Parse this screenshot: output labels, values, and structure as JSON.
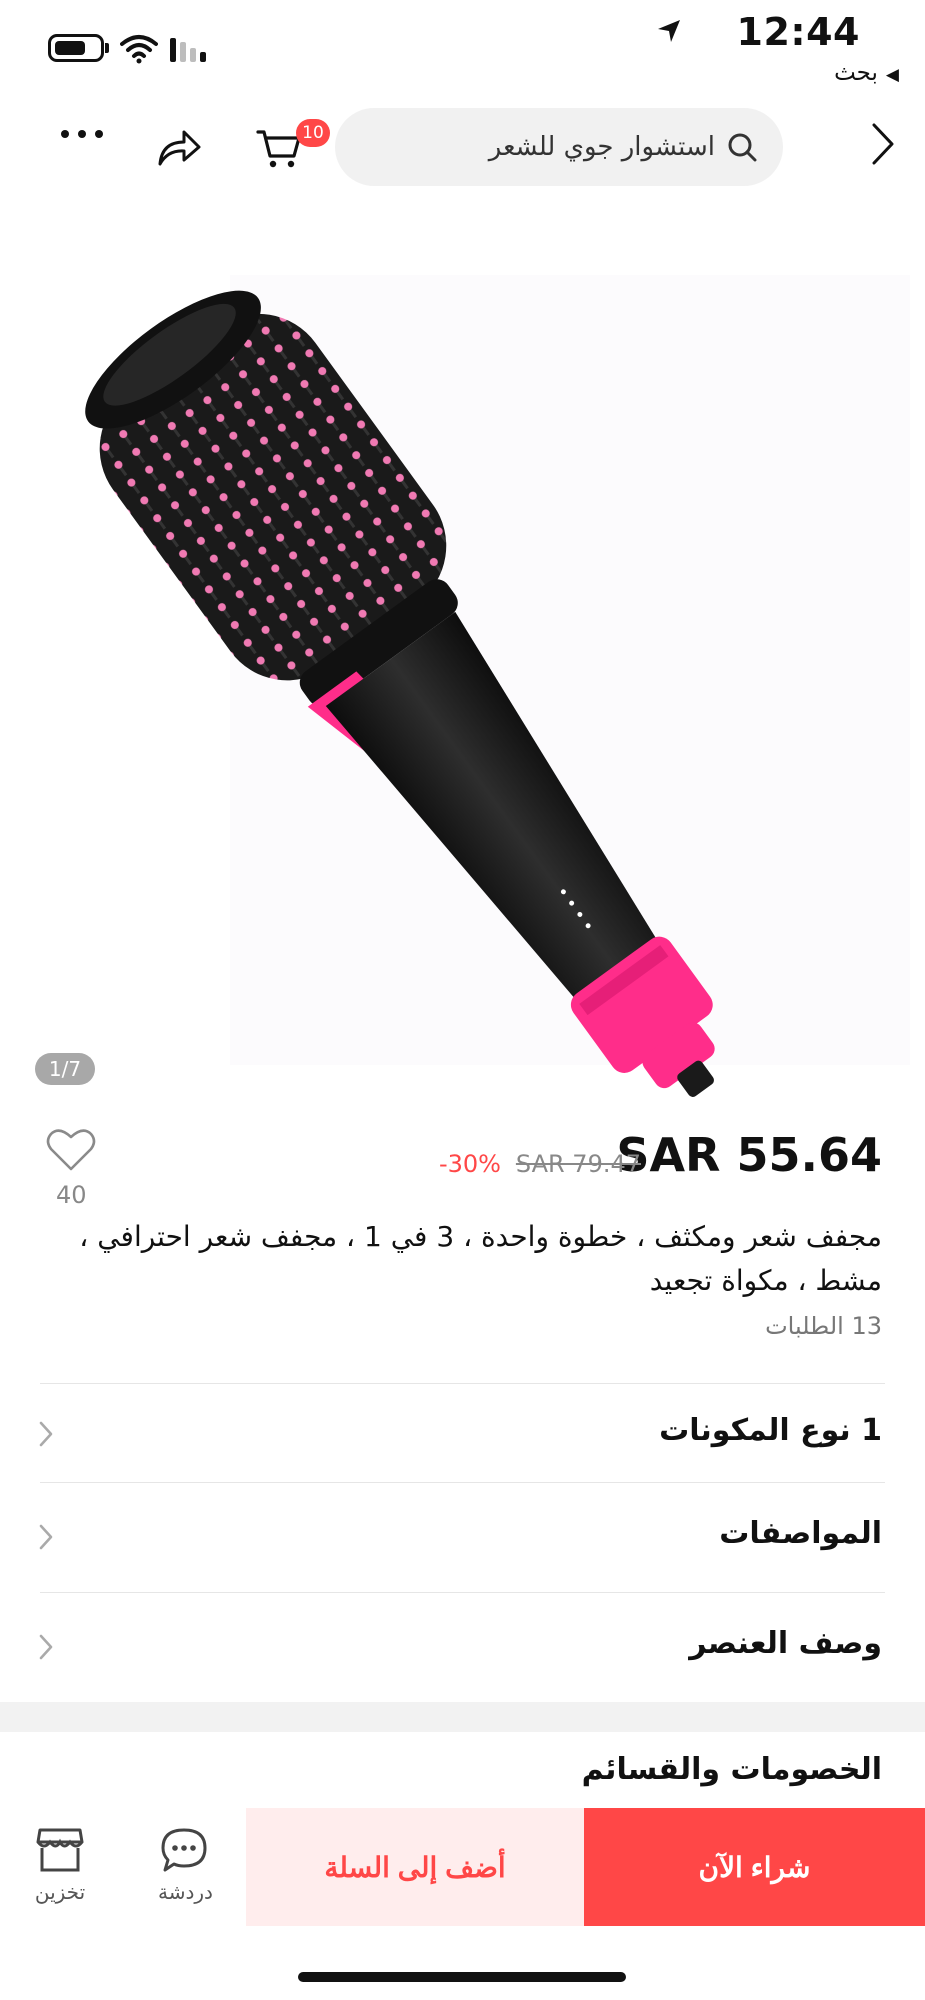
{
  "status_bar": {
    "time": "12:44",
    "back_to_app": "بحث"
  },
  "nav": {
    "search_query": "استشوار جوي للشعر",
    "cart_count": "10"
  },
  "gallery": {
    "page_indicator": "1/7"
  },
  "product": {
    "price": "SAR 55.64",
    "original_price": "SAR 79.47",
    "discount": "-30%",
    "wishlist_count": "40",
    "title": "مجفف شعر ومكثف ، خطوة واحدة ، 3 في 1 ، مجفف شعر احترافي ، مشط ، مكواة تجعيد",
    "orders": "13 الطلبات"
  },
  "sections": {
    "variants": "1 نوع المكونات",
    "specifications": "المواصفات",
    "description": "وصف العنصر",
    "coupons": "الخصومات والقسائم"
  },
  "bottom_bar": {
    "buy_now": "شراء الآن",
    "add_to_cart": "أضف إلى السلة",
    "chat": "دردشة",
    "store": "تخزين"
  },
  "colors": {
    "accent": "#ff4747",
    "accent_light": "#ffeded",
    "product_pink": "#ff2d8a"
  }
}
